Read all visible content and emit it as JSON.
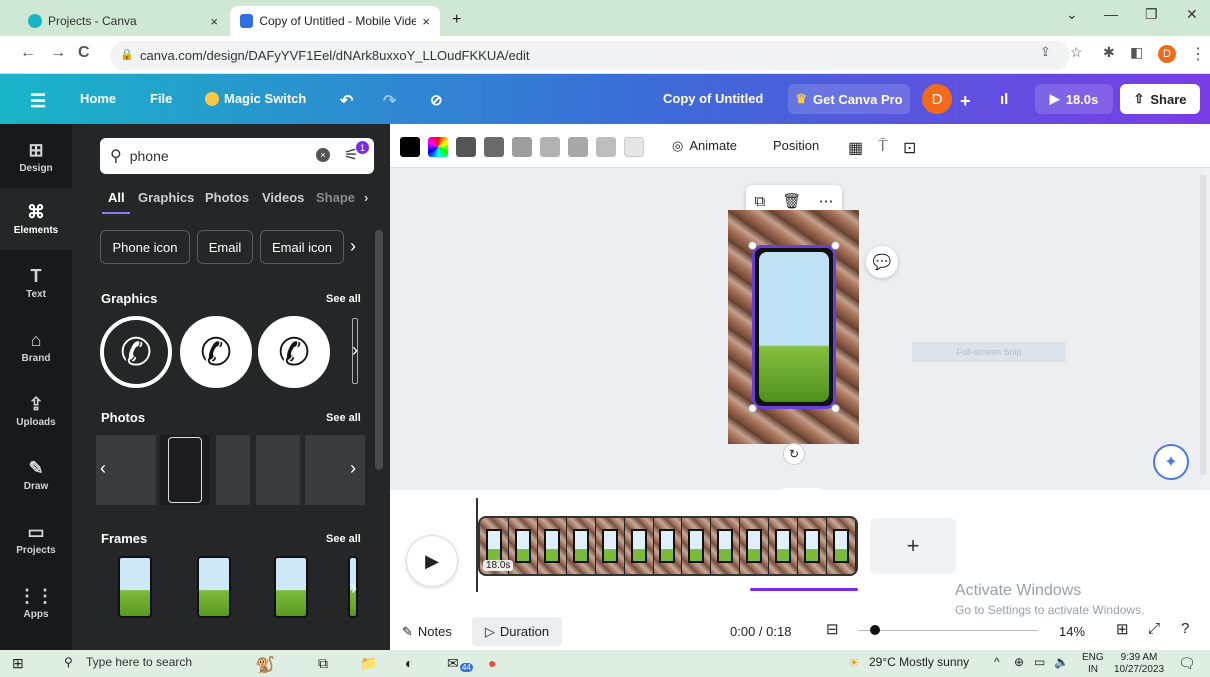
{
  "browser": {
    "tabs": [
      {
        "title": "Projects - Canva",
        "close": "×",
        "active": false
      },
      {
        "title": "Copy of Untitled - Mobile Video",
        "close": "×",
        "active": true
      }
    ],
    "new_tab": "+",
    "url": "canva.com/design/DAFyYVF1Eel/dNArk8uxxoY_LLOudFKKUA/edit",
    "profile_initial": "D"
  },
  "header": {
    "home": "Home",
    "file": "File",
    "magic_switch": "Magic Switch",
    "doc_title": "Copy of Untitled",
    "get_pro": "Get Canva Pro",
    "avatar": "D",
    "play_duration": "18.0s",
    "share": "Share"
  },
  "rail": [
    {
      "label": "Design",
      "icon": "layout-icon"
    },
    {
      "label": "Elements",
      "icon": "shapes-icon"
    },
    {
      "label": "Text",
      "icon": "text-icon"
    },
    {
      "label": "Brand",
      "icon": "brand-icon"
    },
    {
      "label": "Uploads",
      "icon": "upload-icon"
    },
    {
      "label": "Draw",
      "icon": "draw-icon"
    },
    {
      "label": "Projects",
      "icon": "folder-icon"
    },
    {
      "label": "Apps",
      "icon": "apps-icon"
    }
  ],
  "panel": {
    "search_value": "phone",
    "filter_badge": "1",
    "tabs": [
      "All",
      "Graphics",
      "Photos",
      "Videos",
      "Shape"
    ],
    "chips": [
      "Phone icon",
      "Email",
      "Email icon"
    ],
    "sections": {
      "graphics": "Graphics",
      "photos": "Photos",
      "frames": "Frames",
      "see_all": "See all"
    }
  },
  "toolbar": {
    "swatches": [
      "#000000",
      "rainbow",
      "#555555",
      "#6b6b6b",
      "#9e9e9e",
      "#b3b3b3",
      "#a8a8a8",
      "#bdbdbd",
      "#e6e6e6"
    ],
    "animate": "Animate",
    "position": "Position"
  },
  "canvas": {
    "snip_label": "Full-screen Snip"
  },
  "timeline": {
    "clip_duration": "18.0s",
    "notes": "Notes",
    "duration": "Duration",
    "time": "0:00 / 0:18",
    "zoom": "14%",
    "activate_title": "Activate Windows",
    "activate_sub": "Go to Settings to activate Windows."
  },
  "taskbar": {
    "search_placeholder": "Type here to search",
    "weather": "29°C  Mostly sunny",
    "lang": "ENG",
    "region": "IN",
    "time": "9:39 AM",
    "date": "10/27/2023",
    "mail_badge": "44"
  }
}
